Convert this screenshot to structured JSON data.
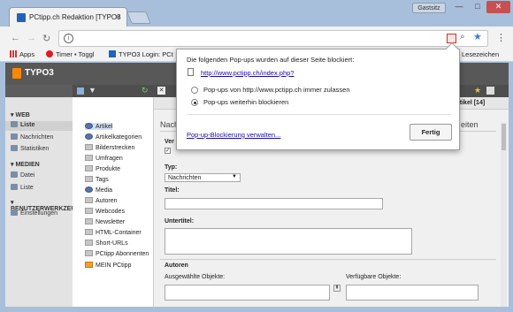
{
  "browser": {
    "tab_title": "PCtipp.ch Redaktion [TYPO3",
    "guest_label": "Gastsitz",
    "omnibox_url": "",
    "bookmarks": [
      {
        "label": "Apps",
        "icon": "apps-icon"
      },
      {
        "label": "Timer • Toggl",
        "icon": "toggl-icon"
      },
      {
        "label": "TYPO3 Login: PCt",
        "icon": "typo3-icon"
      },
      {
        "label": "Lesezeichen",
        "icon": "bookmarks-folder-icon"
      }
    ]
  },
  "popup": {
    "heading": "Die folgenden Pop-ups wurden auf dieser Seite blockiert:",
    "blocked_url": "http://www.pctipp.ch/index.php?",
    "option_allow": "Pop-ups von http://www.pctipp.ch immer zulassen",
    "option_block": "Pop-ups weiterhin blockieren",
    "selected": "block",
    "manage_link": "Pop-up-Blockierung verwalten...",
    "done_button": "Fertig"
  },
  "typo3": {
    "logo_text": "TYPO3",
    "right_label": "Artikel [14]",
    "modules": {
      "web_title": "WEB",
      "web_items": [
        "Liste",
        "Nachrichten",
        "Statistiken"
      ],
      "media_title": "MEDIEN",
      "media_items": [
        "Datei",
        "Liste"
      ],
      "user_title": "BENUTZERWERKZEUGE",
      "user_items": [
        "Einstellungen"
      ]
    },
    "tree": [
      "Artikel",
      "Artikelkategorien",
      "Bilderstrecken",
      "Umfragen",
      "Produkte",
      "Tags",
      "Media",
      "Autoren",
      "Webcodes",
      "Newsletter",
      "HTML-Container",
      "Short-URLs",
      "PCtipp Abonnenten",
      "MEIN PCtipp"
    ],
    "form": {
      "heading_left": "Nach",
      "heading_right": "eiten",
      "small_label": "Ver",
      "typ_label": "Typ:",
      "typ_value": "Nachrichten",
      "title_label": "Titel:",
      "subtitle_label": "Untertitel:",
      "authors_label": "Autoren",
      "selected_objects": "Ausgewählte Objekte:",
      "available_objects": "Verfügbare Objekte:"
    }
  },
  "colors": {
    "typo3_orange": "#ff8700",
    "link_blue": "#1a0dab",
    "frame_blue": "#a8bfdc"
  }
}
